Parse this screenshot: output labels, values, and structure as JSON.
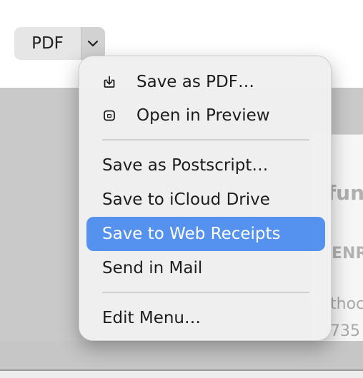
{
  "toolbar": {
    "pdf_button_label": "PDF",
    "pdf_menu_toggle_icon": "chevron-down-icon"
  },
  "pdf_menu": {
    "items": [
      {
        "label": "Save as PDF…",
        "icon": "save-download-icon",
        "highlighted": false
      },
      {
        "label": "Open in Preview",
        "icon": "preview-app-icon",
        "highlighted": false
      },
      {
        "label": "Save as Postscript…",
        "highlighted": false
      },
      {
        "label": "Save to iCloud Drive",
        "highlighted": false
      },
      {
        "label": "Save to Web Receipts",
        "highlighted": true
      },
      {
        "label": "Send in Mail",
        "highlighted": false
      },
      {
        "label": "Edit Menu…",
        "highlighted": false
      }
    ]
  },
  "background_preview": {
    "fragments": [
      "fun",
      "ENR",
      "thoc",
      "735"
    ]
  },
  "colors": {
    "highlight": "#5592ef",
    "menu_background": "#f0f0f0",
    "preview_background": "#c9c9c9"
  }
}
